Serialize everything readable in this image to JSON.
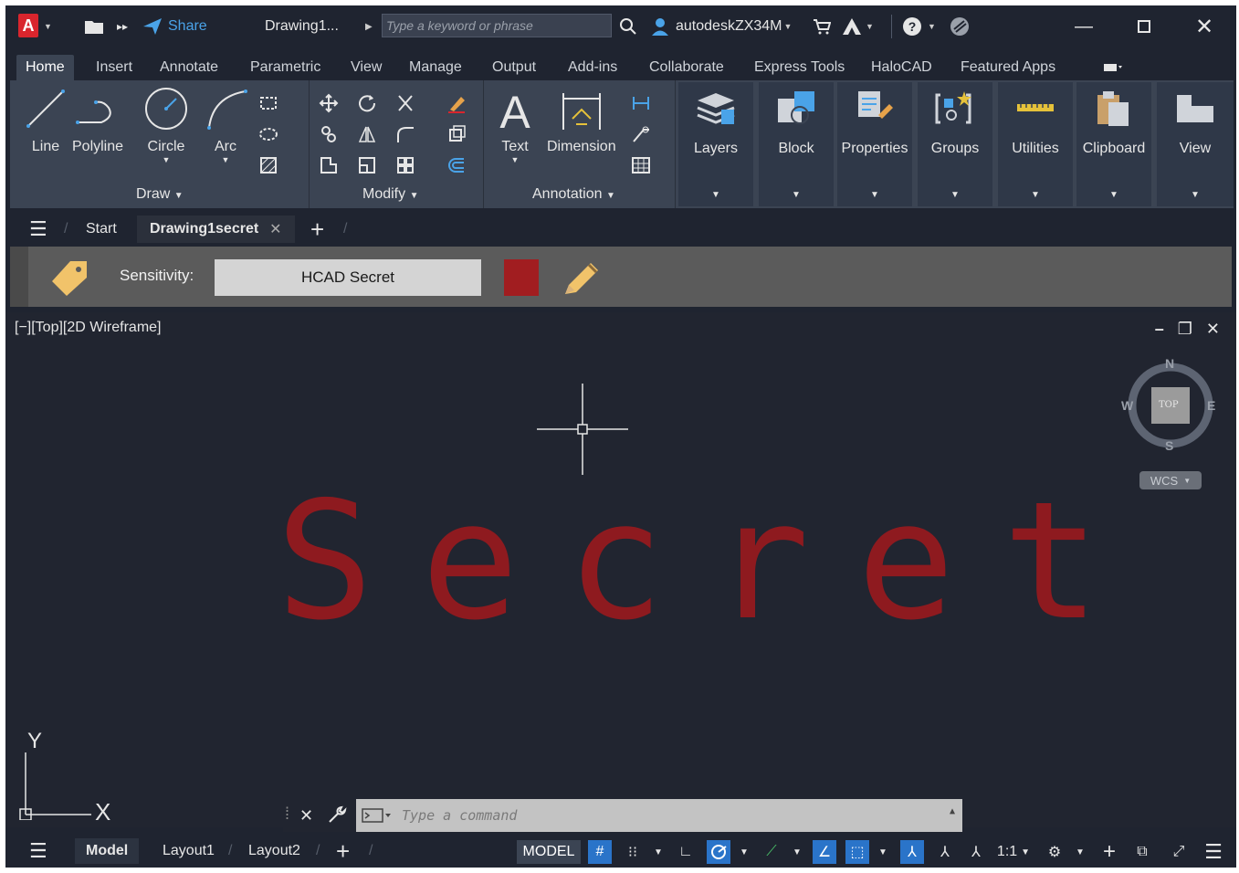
{
  "titlebar": {
    "logo": "A",
    "share_label": "Share",
    "doc_title": "Drawing1...",
    "search_placeholder": "Type a keyword or phrase",
    "user": "autodeskZX34M"
  },
  "ribbon_tabs": [
    "Home",
    "Insert",
    "Annotate",
    "Parametric",
    "View",
    "Manage",
    "Output",
    "Add-ins",
    "Collaborate",
    "Express Tools",
    "HaloCAD",
    "Featured Apps"
  ],
  "ribbon": {
    "draw": {
      "line": "Line",
      "polyline": "Polyline",
      "circle": "Circle",
      "arc": "Arc",
      "title": "Draw"
    },
    "modify": {
      "title": "Modify"
    },
    "annotation": {
      "text": "Text",
      "dimension": "Dimension",
      "title": "Annotation"
    },
    "panels": [
      "Layers",
      "Block",
      "Properties",
      "Groups",
      "Utilities",
      "Clipboard",
      "View"
    ]
  },
  "doc_tabs": {
    "start": "Start",
    "active": "Drawing1secret"
  },
  "sensitivity": {
    "label": "Sensitivity:",
    "value": "HCAD Secret",
    "color": "#a11d20"
  },
  "viewport": {
    "label": "[−][Top][2D Wireframe]",
    "watermark": "Secret",
    "viewcube": {
      "n": "N",
      "s": "S",
      "e": "E",
      "w": "W",
      "face": "TOP",
      "wcs": "WCS"
    },
    "ucs": {
      "x": "X",
      "y": "Y"
    }
  },
  "command_line": {
    "placeholder": "Type a command"
  },
  "status": {
    "tabs": [
      "Model",
      "Layout1",
      "Layout2"
    ],
    "model_label": "MODEL",
    "scale": "1:1"
  }
}
